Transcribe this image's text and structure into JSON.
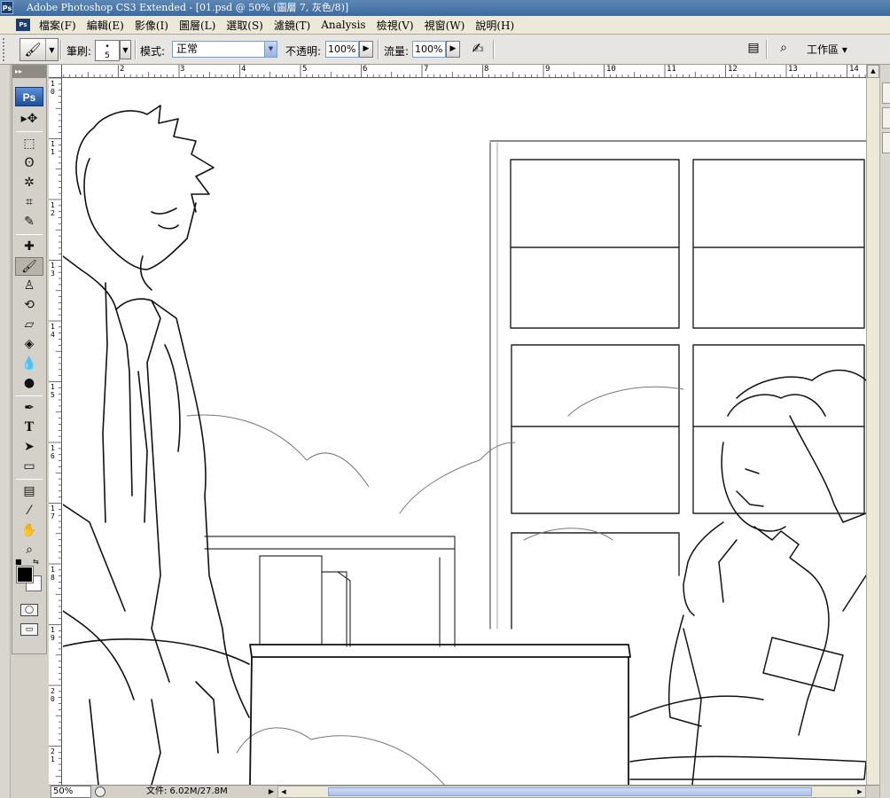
{
  "titlebar": {
    "title": "Adobe Photoshop CS3 Extended - [01.psd @ 50% (圖層 7, 灰色/8)]",
    "logo": "Ps"
  },
  "menubar": {
    "items": [
      "檔案(F)",
      "編輯(E)",
      "影像(I)",
      "圖層(L)",
      "選取(S)",
      "濾鏡(T)",
      "Analysis",
      "檢視(V)",
      "視窗(W)",
      "說明(H)"
    ]
  },
  "options": {
    "brush_label": "筆刷:",
    "brush_size": "5",
    "mode_label": "模式:",
    "mode_value": "正常",
    "opacity_label": "不透明:",
    "opacity_value": "100%",
    "flow_label": "流量:",
    "flow_value": "100%",
    "workspace_label": "工作區 ▾"
  },
  "tools": {
    "logo": "Ps",
    "items": [
      {
        "name": "move-tool",
        "glyph": "▸✥"
      },
      {
        "name": "marquee-tool",
        "glyph": "⬚"
      },
      {
        "name": "lasso-tool",
        "glyph": "ʘ"
      },
      {
        "name": "magic-wand-tool",
        "glyph": "✲"
      },
      {
        "name": "crop-tool",
        "glyph": "⌗"
      },
      {
        "name": "slice-tool",
        "glyph": "✎"
      },
      {
        "name": "healing-brush-tool",
        "glyph": "✚"
      },
      {
        "name": "brush-tool",
        "glyph": "🖌"
      },
      {
        "name": "clone-stamp-tool",
        "glyph": "♙"
      },
      {
        "name": "history-brush-tool",
        "glyph": "⟲"
      },
      {
        "name": "eraser-tool",
        "glyph": "▱"
      },
      {
        "name": "paint-bucket-tool",
        "glyph": "◈"
      },
      {
        "name": "blur-tool",
        "glyph": "💧"
      },
      {
        "name": "dodge-tool",
        "glyph": "●"
      },
      {
        "name": "pen-tool",
        "glyph": "✒"
      },
      {
        "name": "type-tool",
        "glyph": "T"
      },
      {
        "name": "path-selection-tool",
        "glyph": "➤"
      },
      {
        "name": "shape-tool",
        "glyph": "▭"
      },
      {
        "name": "notes-tool",
        "glyph": "▤"
      },
      {
        "name": "eyedropper-tool",
        "glyph": "⁄"
      },
      {
        "name": "hand-tool",
        "glyph": "✋"
      },
      {
        "name": "zoom-tool",
        "glyph": "⌕"
      }
    ]
  },
  "ruler": {
    "h_labels": [
      "1",
      "2",
      "3",
      "4",
      "5",
      "6",
      "7",
      "8",
      "9",
      "10",
      "11",
      "12",
      "13",
      "14"
    ],
    "v_labels": [
      "1 0",
      "1 1",
      "1 2",
      "1 3",
      "1 4",
      "1 5",
      "1 6",
      "1 7",
      "1 8",
      "1 9",
      "2 0",
      "2 1"
    ]
  },
  "statusbar": {
    "zoom": "50%",
    "doc_info": "文件: 6.02M/27.8M"
  },
  "colors": {
    "foreground": "#000000",
    "background": "#ffffff",
    "title_bar": "#3d6a9e"
  }
}
